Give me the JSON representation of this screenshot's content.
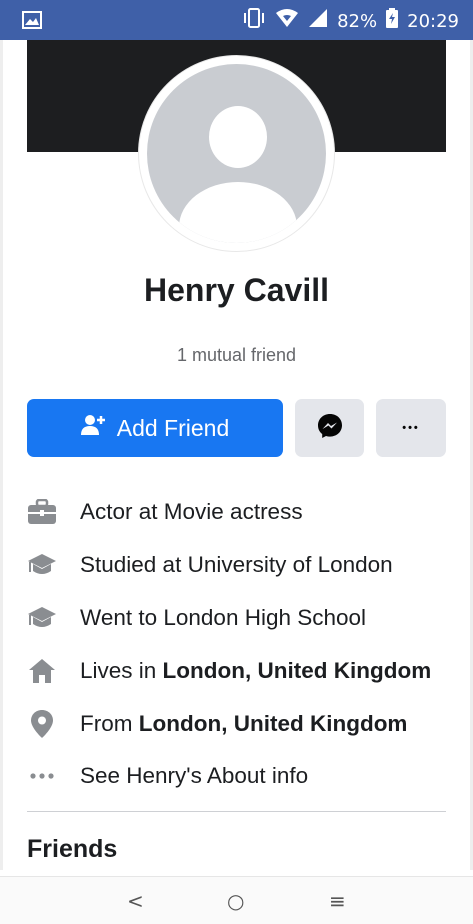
{
  "status_bar": {
    "battery": "82%",
    "time": "20:29",
    "icons": [
      "image-icon",
      "vibrate-icon",
      "wifi-icon",
      "signal-icon",
      "battery-icon"
    ]
  },
  "profile": {
    "name": "Henry Cavill",
    "mutual": "1 mutual friend"
  },
  "actions": {
    "add_friend": "Add Friend",
    "more": "•••"
  },
  "info": [
    {
      "icon": "briefcase-icon",
      "text": "Actor at Movie actress",
      "bold": ""
    },
    {
      "icon": "graduation-cap-icon",
      "text": "Studied at University of London",
      "bold": ""
    },
    {
      "icon": "graduation-cap-icon",
      "text": "Went to London High School",
      "bold": ""
    },
    {
      "icon": "home-icon",
      "prefix": "Lives in ",
      "bold": "London, United Kingdom"
    },
    {
      "icon": "location-pin-icon",
      "prefix": "From ",
      "bold": "London, United Kingdom"
    },
    {
      "icon": "more-dots-icon",
      "text": "See Henry's About info",
      "bold": ""
    }
  ],
  "friends": {
    "title": "Friends"
  },
  "nav": {
    "back": "<",
    "home": "○",
    "menu": "≡"
  },
  "colors": {
    "status_bar": "#3f60a8",
    "primary": "#1877f2",
    "button_gray": "#e4e6eb",
    "cover": "#1d1e20",
    "icon_gray": "#8a8d91"
  }
}
